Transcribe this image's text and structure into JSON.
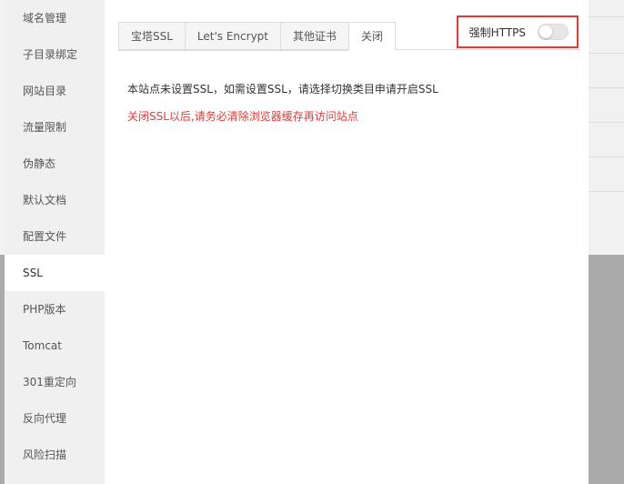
{
  "sidebar": {
    "items": [
      {
        "label": "域名管理"
      },
      {
        "label": "子目录绑定"
      },
      {
        "label": "网站目录"
      },
      {
        "label": "流量限制"
      },
      {
        "label": "伪静态"
      },
      {
        "label": "默认文档"
      },
      {
        "label": "配置文件"
      },
      {
        "label": "SSL"
      },
      {
        "label": "PHP版本"
      },
      {
        "label": "Tomcat"
      },
      {
        "label": "301重定向"
      },
      {
        "label": "反向代理"
      },
      {
        "label": "风险扫描"
      }
    ],
    "active_index": 7
  },
  "tabs": [
    {
      "label": "宝塔SSL"
    },
    {
      "label": "Let's Encrypt"
    },
    {
      "label": "其他证书"
    },
    {
      "label": "关闭"
    }
  ],
  "active_tab": 3,
  "force_https": {
    "label": "强制HTTPS",
    "enabled": false
  },
  "messages": {
    "info": "本站点未设置SSL，如需设置SSL，请选择切换类目申请开启SSL",
    "warning": "关闭SSL以后,请务必清除浏览器缓存再访问站点"
  },
  "colors": {
    "warning": "#e53935",
    "highlight_border": "#e53935"
  }
}
